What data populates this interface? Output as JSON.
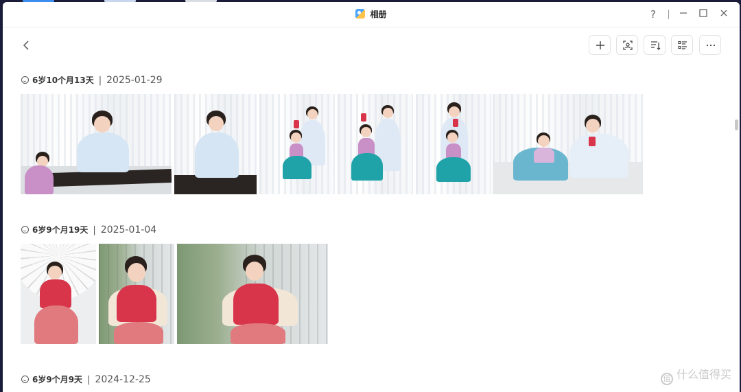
{
  "window": {
    "title": "相册",
    "controls": {
      "help": "?",
      "minimize": "—",
      "maximize": "☐",
      "close": "✕"
    }
  },
  "nav": {
    "back_glyph": "‹"
  },
  "toolbar": {
    "buttons": [
      {
        "name": "add-button",
        "icon": "plus-icon"
      },
      {
        "name": "face-scan-button",
        "icon": "face-scan-icon"
      },
      {
        "name": "sort-button",
        "icon": "sort-icon"
      },
      {
        "name": "view-mode-button",
        "icon": "list-view-icon"
      },
      {
        "name": "more-button",
        "icon": "more-icon"
      }
    ]
  },
  "sections": [
    {
      "age": "6岁10个月13天",
      "separator": "|",
      "date": "2025-01-29",
      "photo_count": 6
    },
    {
      "age": "6岁9个月19天",
      "separator": "|",
      "date": "2025-01-04",
      "photo_count": 3
    },
    {
      "age": "6岁9个月9天",
      "separator": "|",
      "date": "2024-12-25",
      "photo_count": 0
    }
  ],
  "watermark": {
    "badge": "值",
    "text": "什么值得买"
  },
  "colors": {
    "window_bg": "#ffffff",
    "desktop_bg": "#1a1c3a",
    "accent_blue": "#4aa6ff",
    "dress_teal": "#1fa3a8",
    "dress_red": "#d8354a",
    "dress_pink": "#c98fc7",
    "dress_white_blue": "#cfe3f5"
  }
}
